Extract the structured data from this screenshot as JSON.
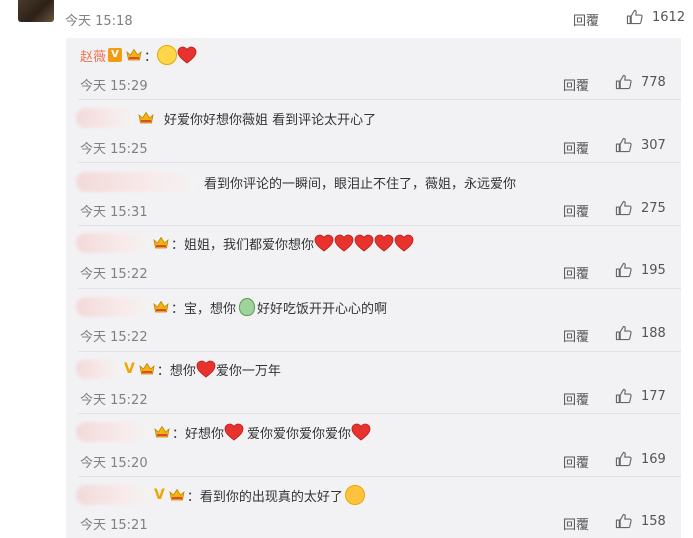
{
  "top_comment": {
    "time": "今天 15:18",
    "reply_label": "回覆",
    "likes": "1612"
  },
  "replies": [
    {
      "author": "赵薇",
      "text_before": "：",
      "text_after": "",
      "time": "今天 15:29",
      "reply_label": "回覆",
      "likes": "778"
    },
    {
      "text": "好爱你好想你薇姐 看到评论太开心了",
      "time": "今天 15:25",
      "reply_label": "回覆",
      "likes": "307"
    },
    {
      "text": "看到你评论的一瞬间，眼泪止不住了，薇姐，永远爱你",
      "time": "今天 15:31",
      "reply_label": "回覆",
      "likes": "275"
    },
    {
      "text": "：姐姐，我们都爱你想你",
      "time": "今天 15:22",
      "reply_label": "回覆",
      "likes": "195"
    },
    {
      "text_a": "：宝，想你",
      "text_b": "好好吃饭开开心心的啊",
      "time": "今天 15:22",
      "reply_label": "回覆",
      "likes": "188"
    },
    {
      "text_a": "：想你",
      "text_b": "爱你一万年",
      "time": "今天 15:22",
      "reply_label": "回覆",
      "likes": "177"
    },
    {
      "text_a": "：好想你",
      "text_b": "爱你爱你爱你爱你",
      "time": "今天 15:20",
      "reply_label": "回覆",
      "likes": "169"
    },
    {
      "text": "：看到你的出现真的太好了",
      "time": "今天 15:21",
      "reply_label": "回覆",
      "likes": "158"
    }
  ],
  "icons": {
    "like": "thumbs-up-icon",
    "heart": "red-heart-icon",
    "crown": "crown-badge-icon",
    "vip": "v-badge-icon"
  },
  "colors": {
    "author_name": "#eb7350",
    "heart": "#e8322e",
    "panel_bg": "#f2f2f5"
  }
}
